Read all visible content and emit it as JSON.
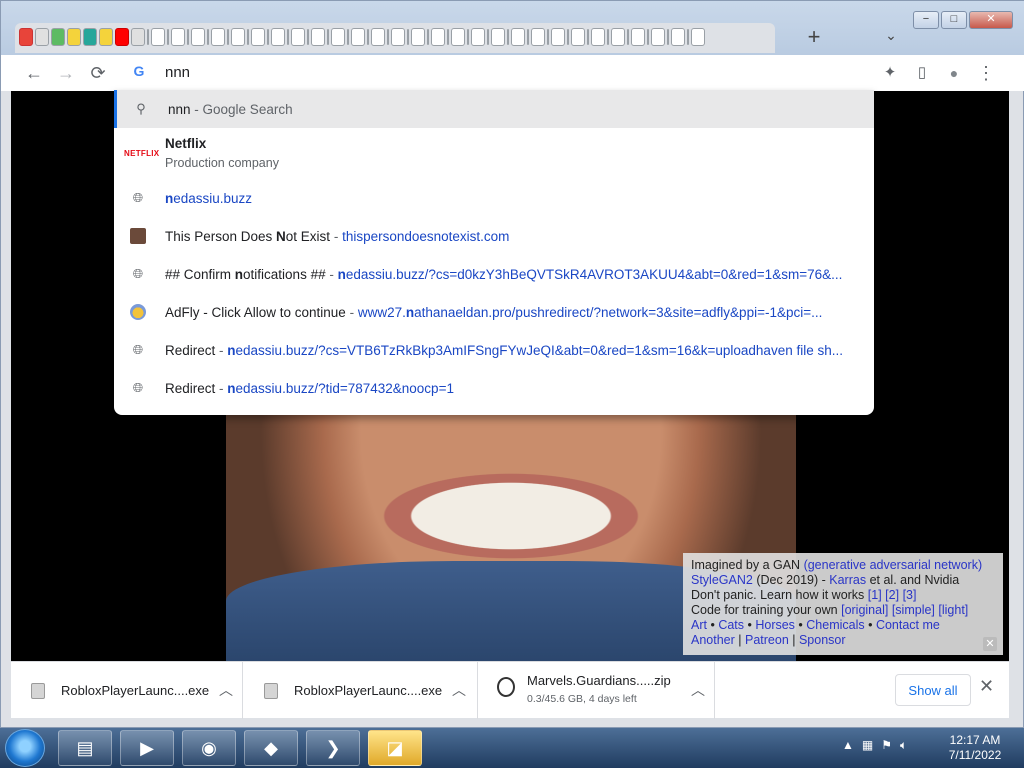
{
  "browser": {
    "new_tab": "+",
    "tab_search": "⌄",
    "controls": {
      "minimize": "−",
      "maximize": "□",
      "close": "✕"
    }
  },
  "toolbar": {
    "back": "←",
    "forward": "→",
    "reload": "⟳",
    "google_icon": "G",
    "omnibox_value": "nnn",
    "extensions": "✦",
    "side_panel": "▯",
    "profile": "●",
    "menu": "⋮"
  },
  "suggestions": [
    {
      "type": "search",
      "icon": "search-icon",
      "pre": "",
      "bold": "",
      "post": "nnn",
      "dim": " - Google Search",
      "url": ""
    },
    {
      "type": "entity",
      "logo": "NETFLIX",
      "bold": "N",
      "post": "etflix",
      "sub": "Production company"
    },
    {
      "type": "url",
      "icon": "globe-icon",
      "bold": "n",
      "post": "edassiu.buzz"
    },
    {
      "type": "title",
      "icon": "avatar",
      "title_pre": "This Person Does ",
      "title_bold": "N",
      "title_post": "ot Exist",
      "sep": " - ",
      "url": "thispersondoesnotexist.com"
    },
    {
      "type": "title",
      "icon": "globe-icon",
      "title_pre": "## Confirm ",
      "title_bold": "n",
      "title_post": "otifications ##",
      "sep": " - ",
      "url_bold": "n",
      "url": "edassiu.buzz/?cs=d0kzY3hBeQVTSkR4AVROT3AKUU4&abt=0&red=1&sm=76&..."
    },
    {
      "type": "title",
      "icon": "bee",
      "title_pre": "AdFly - Click Allow to continue",
      "sep": " - ",
      "url_pre": "www27.",
      "url_bold": "n",
      "url": "athanaeldan.pro/pushredirect/?network=3&site=adfly&ppi=-1&pci=..."
    },
    {
      "type": "title",
      "icon": "globe-icon",
      "title_pre": "Redirect",
      "sep": " - ",
      "url_bold": "n",
      "url": "edassiu.buzz/?cs=VTB6TzRkBkp3AmIFSngFYwJeQI&abt=0&red=1&sm=16&k=uploadhaven file sh..."
    },
    {
      "type": "title",
      "icon": "globe-icon",
      "title_pre": "Redirect",
      "sep": " - ",
      "url_bold": "n",
      "url": "edassiu.buzz/?tid=787432&noocp=1"
    }
  ],
  "gan_box": {
    "line1_text": "Imagined by a GAN ",
    "line1_link": "(generative adversarial network)",
    "line2_link": "StyleGAN2",
    "line2_text": " (Dec 2019) - ",
    "line2_link2": "Karras",
    "line2_text2": " et al. and Nvidia",
    "line3_text": "Don't panic. Learn how it works ",
    "line3_links": [
      "[1]",
      "[2]",
      "[3]"
    ],
    "line4_text": "Code for training your own ",
    "line4_links": [
      "[original]",
      "[simple]",
      "[light]"
    ],
    "line5_links": [
      "Art",
      "Cats",
      "Horses",
      "Chemicals",
      "Contact me"
    ],
    "line6_links": [
      "Another",
      "Patreon",
      "Sponsor"
    ],
    "close": "✕"
  },
  "downloads": {
    "items": [
      {
        "name": "RobloxPlayerLaunc....exe",
        "sub": ""
      },
      {
        "name": "RobloxPlayerLaunc....exe",
        "sub": ""
      },
      {
        "name": "Marvels.Guardians.....zip",
        "sub": "0.3/45.6 GB, 4 days left"
      }
    ],
    "show_all": "Show all",
    "close": "✕"
  },
  "taskbar": {
    "clock_time": "12:17 AM",
    "clock_date": "7/11/2022"
  }
}
